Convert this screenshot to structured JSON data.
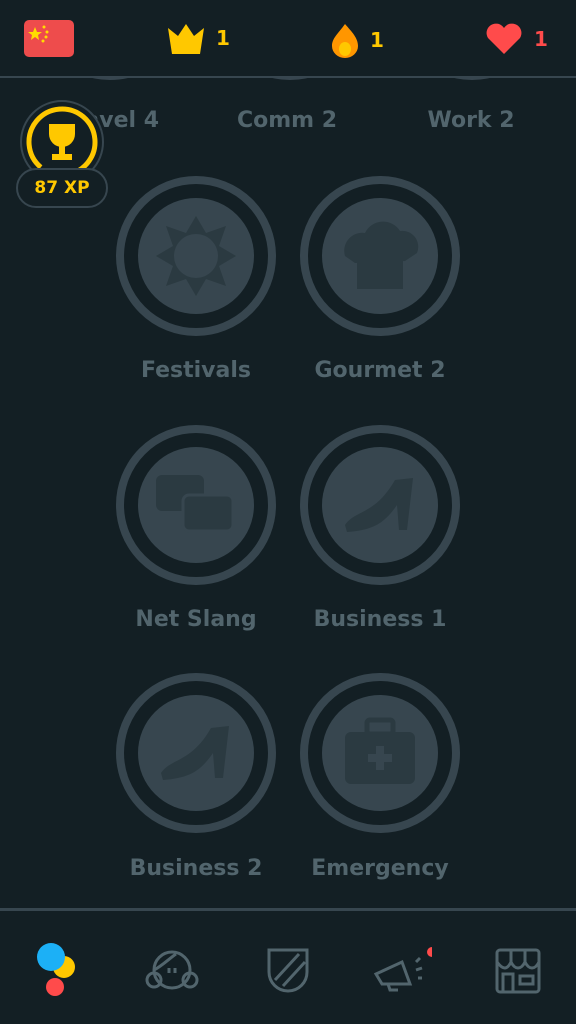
{
  "header": {
    "flag": "china-flag",
    "crowns": "1",
    "streak": "1",
    "hearts": "1"
  },
  "top_row_labels": [
    "Travel 4",
    "Comm 2",
    "Work 2"
  ],
  "xp": {
    "label": "87 XP"
  },
  "skills": [
    {
      "label": "Festivals",
      "icon": "sun-icon"
    },
    {
      "label": "Gourmet 2",
      "icon": "chef-hat-icon"
    },
    {
      "label": "Net Slang",
      "icon": "chat-bubbles-icon"
    },
    {
      "label": "Business 1",
      "icon": "high-heel-icon"
    },
    {
      "label": "Business 2",
      "icon": "high-heel-icon"
    },
    {
      "label": "Emergency",
      "icon": "first-aid-kit-icon"
    }
  ],
  "nav": [
    "learn",
    "profile",
    "leagues",
    "news",
    "shop"
  ],
  "colors": {
    "bg": "#131f24",
    "locked": "#37464f",
    "text": "#52656d",
    "gold": "#ffc800",
    "red": "#ff4b4b",
    "blue": "#1cb0f6"
  }
}
